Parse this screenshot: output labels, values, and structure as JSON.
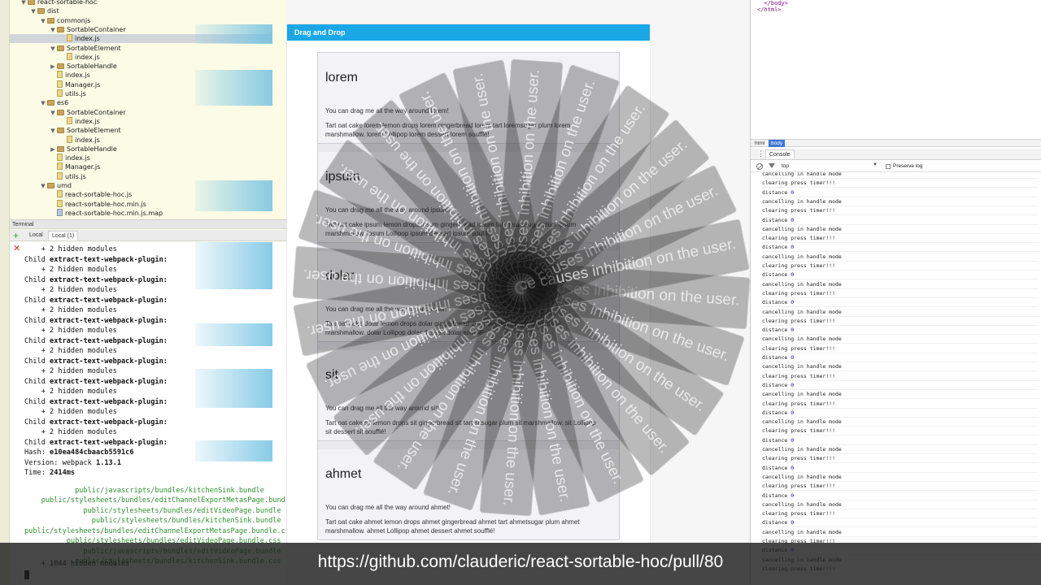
{
  "ide": {
    "tree": [
      {
        "name": "react-sortable-hoc",
        "type": "folder",
        "depth": 0
      },
      {
        "name": "dist",
        "type": "folder",
        "depth": 1
      },
      {
        "name": "commonjs",
        "type": "folder",
        "depth": 2
      },
      {
        "name": "SortableContainer",
        "type": "folder",
        "depth": 3
      },
      {
        "name": "index.js",
        "type": "file",
        "depth": 4,
        "selected": true
      },
      {
        "name": "SortableElement",
        "type": "folder",
        "depth": 3
      },
      {
        "name": "index.js",
        "type": "file",
        "depth": 4
      },
      {
        "name": "SortableHandle",
        "type": "folder",
        "depth": 3,
        "collapsed": true
      },
      {
        "name": "index.js",
        "type": "file",
        "depth": 3
      },
      {
        "name": "Manager.js",
        "type": "file",
        "depth": 3
      },
      {
        "name": "utils.js",
        "type": "file",
        "depth": 3
      },
      {
        "name": "es6",
        "type": "folder",
        "depth": 2
      },
      {
        "name": "SortableContainer",
        "type": "folder",
        "depth": 3
      },
      {
        "name": "index.js",
        "type": "file",
        "depth": 4
      },
      {
        "name": "SortableElement",
        "type": "folder",
        "depth": 3
      },
      {
        "name": "index.js",
        "type": "file",
        "depth": 4
      },
      {
        "name": "SortableHandle",
        "type": "folder",
        "depth": 3,
        "collapsed": true
      },
      {
        "name": "index.js",
        "type": "file",
        "depth": 3
      },
      {
        "name": "Manager.js",
        "type": "file",
        "depth": 3
      },
      {
        "name": "utils.js",
        "type": "file",
        "depth": 3
      },
      {
        "name": "umd",
        "type": "folder",
        "depth": 2
      },
      {
        "name": "react-sortable-hoc.js",
        "type": "file",
        "depth": 3
      },
      {
        "name": "react-sortable-hoc.min.js",
        "type": "file",
        "depth": 3
      },
      {
        "name": "react-sortable-hoc.min.js.map",
        "type": "file",
        "depth": 3
      }
    ],
    "terminal_title": "Terminal",
    "terminal_tabs": [
      "Local",
      "Local (1)"
    ],
    "terminal_lines": [
      {
        "text": "    + 2 hidden modules",
        "bold": ""
      },
      {
        "text": "Child ",
        "bold": "extract-text-webpack-plugin:"
      },
      {
        "text": "    + 2 hidden modules",
        "bold": ""
      },
      {
        "text": "Child ",
        "bold": "extract-text-webpack-plugin:"
      },
      {
        "text": "    + 2 hidden modules",
        "bold": ""
      },
      {
        "text": "Child ",
        "bold": "extract-text-webpack-plugin:"
      },
      {
        "text": "    + 2 hidden modules",
        "bold": ""
      },
      {
        "text": "Child ",
        "bold": "extract-text-webpack-plugin:"
      },
      {
        "text": "    + 2 hidden modules",
        "bold": ""
      },
      {
        "text": "Child ",
        "bold": "extract-text-webpack-plugin:"
      },
      {
        "text": "    + 2 hidden modules",
        "bold": ""
      },
      {
        "text": "Child ",
        "bold": "extract-text-webpack-plugin:"
      },
      {
        "text": "    + 2 hidden modules",
        "bold": ""
      },
      {
        "text": "Child ",
        "bold": "extract-text-webpack-plugin:"
      },
      {
        "text": "    + 2 hidden modules",
        "bold": ""
      },
      {
        "text": "Child ",
        "bold": "extract-text-webpack-plugin:"
      },
      {
        "text": "    + 2 hidden modules",
        "bold": ""
      },
      {
        "text": "Child ",
        "bold": "extract-text-webpack-plugin:"
      },
      {
        "text": "    + 2 hidden modules",
        "bold": ""
      },
      {
        "text": "Child ",
        "bold": "extract-text-webpack-plugin:"
      },
      {
        "text": "Hash: ",
        "bold": "e10ea484cbaacb5591c6"
      },
      {
        "text": "Version: webpack ",
        "bold": "1.13.1"
      },
      {
        "text": "Time: ",
        "bold": "2414ms"
      }
    ],
    "terminal_assets": [
      "            public/javascripts/bundles/kitchenSink.bundle",
      "    public/stylesheets/bundles/editChannelExportMetasPage.bundle",
      "              public/stylesheets/bundles/editVideoPage.bundle",
      "                public/stylesheets/bundles/kitchenSink.bundle",
      "public/stylesheets/bundles/editChannelExportMetasPage.bundle.css",
      "          public/stylesheets/bundles/editVideoPage.bundle.css",
      "              public/javascripts/bundles/editVideoPage.bundle",
      "            public/stylesheets/bundles/kitchenSink.bundle.css"
    ],
    "terminal_footer": "    + 1044 hidden modules"
  },
  "demo": {
    "header": "Drag and Drop",
    "items": [
      {
        "title": "lorem",
        "line1": "You can drag me all the way around lorem!",
        "line2": "Tart oat cake lorem lemon drops lorem gingerbread lorem tart loremsugar plum lorem marshmallow. lorem Lollipop lorem dessert lorem soufflé!"
      },
      {
        "title": "ipsum",
        "line1": "You can drag me all the way around ipsum!",
        "line2": "Tart oat cake ipsum lemon drops ipsum gingerbread ipsum tart ipsumsugar plum ipsum marshmallow. ipsum Lollipop ipsum dessert ipsum soufflé!"
      },
      {
        "title": "dolar",
        "line1": "You can drag me all the way around dolar!",
        "line2": "Tart oat cake dolar lemon drops dolar gingerbread dolar tart dolarsugar plum dolar marshmallow. dolar Lollipop dolar dessert dolar soufflé!"
      },
      {
        "title": "sit",
        "line1": "You can drag me all the way around sit!",
        "line2": "Tart oat cake sit lemon drops sit gingerbread sit tart sitsugar plum sit marshmallow. sit Lollipop sit dessert sit soufflé!"
      },
      {
        "title": "ahmet",
        "line1": "You can drag me all the way around ahmet!",
        "line2": "Tart oat cake ahmet lemon drops ahmet gingerbread ahmet tart ahmetsugar plum ahmet marshmallow. ahmet Lollipop ahmet dessert ahmet soufflé!"
      }
    ],
    "ghost_text": "this experience causes inhibition on the user."
  },
  "devtools": {
    "source_lines": [
      "  </body>",
      "</html>"
    ],
    "breadcrumbs": [
      "html",
      "body"
    ],
    "drawer_tab": "Console",
    "context": "top",
    "preserve_log_label": "Preserve log",
    "console_lines": [
      {
        "text": "cancelling in handle mode"
      },
      {
        "text": "clearing press timer!!!"
      },
      {
        "text": "distance ",
        "num": "0"
      },
      {
        "text": "cancelling in handle mode"
      },
      {
        "text": "clearing press timer!!!"
      },
      {
        "text": "distance ",
        "num": "0"
      },
      {
        "text": "cancelling in handle mode"
      },
      {
        "text": "clearing press timer!!!"
      },
      {
        "text": "distance ",
        "num": "0"
      },
      {
        "text": "cancelling in handle mode"
      },
      {
        "text": "clearing press timer!!!"
      },
      {
        "text": "distance ",
        "num": "0"
      },
      {
        "text": "cancelling in handle mode"
      },
      {
        "text": "clearing press timer!!!"
      },
      {
        "text": "distance ",
        "num": "0"
      },
      {
        "text": "cancelling in handle mode"
      },
      {
        "text": "clearing press timer!!!"
      },
      {
        "text": "distance ",
        "num": "0"
      },
      {
        "text": "cancelling in handle mode"
      },
      {
        "text": "clearing press timer!!!"
      },
      {
        "text": "distance ",
        "num": "0"
      },
      {
        "text": "cancelling in handle mode"
      },
      {
        "text": "clearing press timer!!!"
      },
      {
        "text": "distance ",
        "num": "0"
      },
      {
        "text": "cancelling in handle mode"
      },
      {
        "text": "clearing press timer!!!"
      },
      {
        "text": "distance ",
        "num": "0"
      },
      {
        "text": "cancelling in handle mode"
      },
      {
        "text": "clearing press timer!!!"
      },
      {
        "text": "distance ",
        "num": "0"
      },
      {
        "text": "cancelling in handle mode"
      },
      {
        "text": "clearing press timer!!!"
      },
      {
        "text": "distance ",
        "num": "0"
      },
      {
        "text": "cancelling in handle mode"
      },
      {
        "text": "clearing press timer!!!"
      },
      {
        "text": "distance ",
        "num": "0"
      },
      {
        "text": "cancelling in handle mode"
      },
      {
        "text": "clearing press timer!!!"
      },
      {
        "text": "distance ",
        "num": "0"
      },
      {
        "text": "cancelling in handle mode"
      },
      {
        "text": "clearing press timer!!!"
      },
      {
        "text": "distance ",
        "num": "0"
      },
      {
        "text": "cancelling in handle mode"
      },
      {
        "text": "clearing press timer!!!"
      }
    ]
  },
  "caption": "https://github.com/clauderic/react-sortable-hoc/pull/80"
}
